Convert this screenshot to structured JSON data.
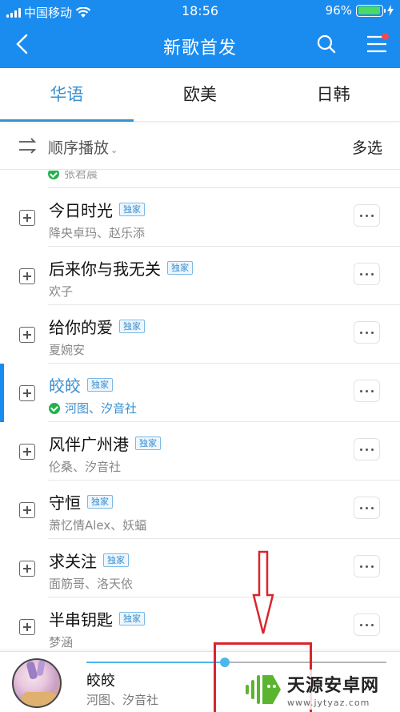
{
  "status_bar": {
    "carrier": "中国移动",
    "time": "18:56",
    "battery": "96%",
    "battery_level": 0.96
  },
  "header": {
    "title": "新歌首发",
    "back_icon": "chevron-left-icon",
    "search_icon": "search-icon",
    "menu_icon": "menu-icon",
    "menu_has_notification": true
  },
  "tabs": [
    {
      "label": "华语",
      "active": true
    },
    {
      "label": "欧美",
      "active": false
    },
    {
      "label": "日韩",
      "active": false
    }
  ],
  "toolbar": {
    "order_icon": "play-order-icon",
    "order_label": "顺序播放",
    "order_caret": "⌄",
    "multi_select": "多选"
  },
  "partial_row": {
    "artist": "张君晨",
    "downloaded": true
  },
  "songs": [
    {
      "title": "今日时光",
      "badge": "独家",
      "artist": "降央卓玛、赵乐添",
      "downloaded": false,
      "playing": false
    },
    {
      "title": "后来你与我无关",
      "badge": "独家",
      "artist": "欢子",
      "downloaded": false,
      "playing": false
    },
    {
      "title": "给你的爱",
      "badge": "独家",
      "artist": "夏婉安",
      "downloaded": false,
      "playing": false
    },
    {
      "title": "皎皎",
      "badge": "独家",
      "artist": "河图、汐音社",
      "downloaded": true,
      "playing": true
    },
    {
      "title": "风伴广州港",
      "badge": "独家",
      "artist": "伦桑、汐音社",
      "downloaded": false,
      "playing": false
    },
    {
      "title": "守恒",
      "badge": "独家",
      "artist": "萧忆情Alex、妖蝠",
      "downloaded": false,
      "playing": false
    },
    {
      "title": "求关注",
      "badge": "独家",
      "artist": "面筋哥、洛天依",
      "downloaded": false,
      "playing": false
    },
    {
      "title": "半串钥匙",
      "badge": "独家",
      "artist": "梦涵",
      "downloaded": false,
      "playing": false
    }
  ],
  "now_playing": {
    "title": "皎皎",
    "artist": "河图、汐音社",
    "progress": 0.46
  },
  "colors": {
    "header": "#1a8cf0",
    "accent": "#3a8fd0",
    "progress": "#4ab8ec",
    "annotation": "#d8262c",
    "downloaded": "#21b24b"
  },
  "watermark": {
    "name": "天源安卓网",
    "url": "www.jytyaz.com"
  }
}
